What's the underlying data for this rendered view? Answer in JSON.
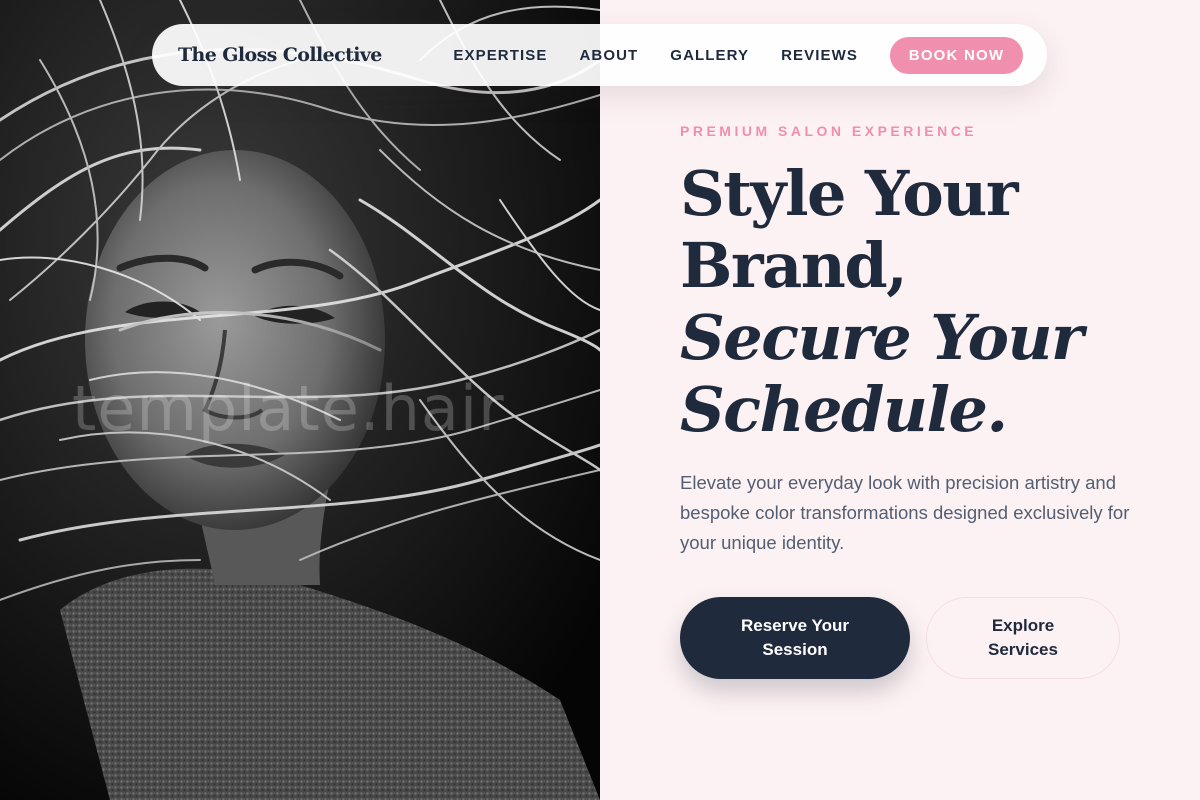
{
  "brand": {
    "name": "The Gloss Collective"
  },
  "nav": {
    "links": [
      {
        "label": "EXPERTISE"
      },
      {
        "label": "ABOUT"
      },
      {
        "label": "GALLERY"
      },
      {
        "label": "REVIEWS"
      }
    ],
    "cta_label": "BOOK NOW"
  },
  "hero": {
    "eyebrow": "PREMIUM SALON EXPERIENCE",
    "headline": {
      "line1": "Style Your",
      "line2": "Brand,",
      "line3": "Secure Your",
      "line4": "Schedule."
    },
    "subcopy": "Elevate your everyday look with precision artistry and bespoke color transformations designed exclusively for your unique identity.",
    "primary_button": "Reserve Your Session",
    "secondary_button": "Explore Services"
  },
  "photo": {
    "watermark": "template.hair"
  },
  "colors": {
    "accent_pink": "#f08fae",
    "navy": "#1f2a3d",
    "page_background": "#fdf2f3"
  }
}
